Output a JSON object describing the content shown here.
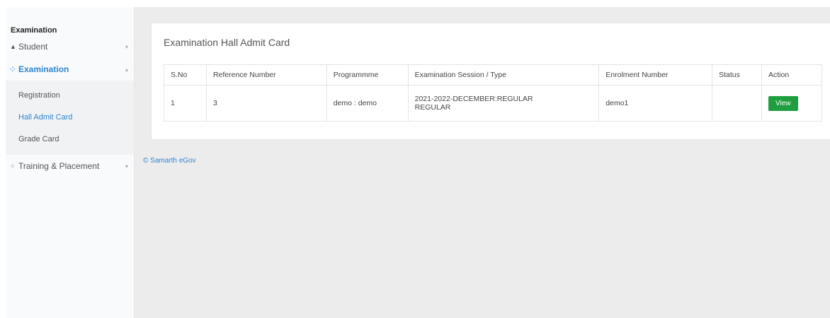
{
  "sidebar": {
    "heading": "Examination",
    "items": [
      {
        "label": "Student",
        "icon": "user-icon",
        "glyph": "▲",
        "chevron": "▾"
      },
      {
        "label": "Examination",
        "icon": "users-icon",
        "glyph": "⁘",
        "chevron": "▴"
      },
      {
        "label": "Training & Placement",
        "icon": "users-icon",
        "glyph": "⁘",
        "chevron": "▾"
      }
    ],
    "submenu": [
      "Registration",
      "Hall Admit Card",
      "Grade Card"
    ]
  },
  "card": {
    "title": "Examination Hall Admit Card",
    "columns": [
      "S.No",
      "Reference Number",
      "Programmme",
      "Examination Session / Type",
      "Enrolment Number",
      "Status",
      "Action"
    ],
    "row": {
      "sno": "1",
      "reference": "3",
      "programme": "demo : demo",
      "session_line1": "2021-2022-DECEMBER:REGULAR",
      "session_line2": "REGULAR",
      "enrolment": "demo1",
      "status": "",
      "action": "View"
    }
  },
  "footer": {
    "text": "© Samarth eGov"
  },
  "colors": {
    "accent": "#2d86d1",
    "button": "#1e9e3e",
    "background": "#ececed"
  }
}
